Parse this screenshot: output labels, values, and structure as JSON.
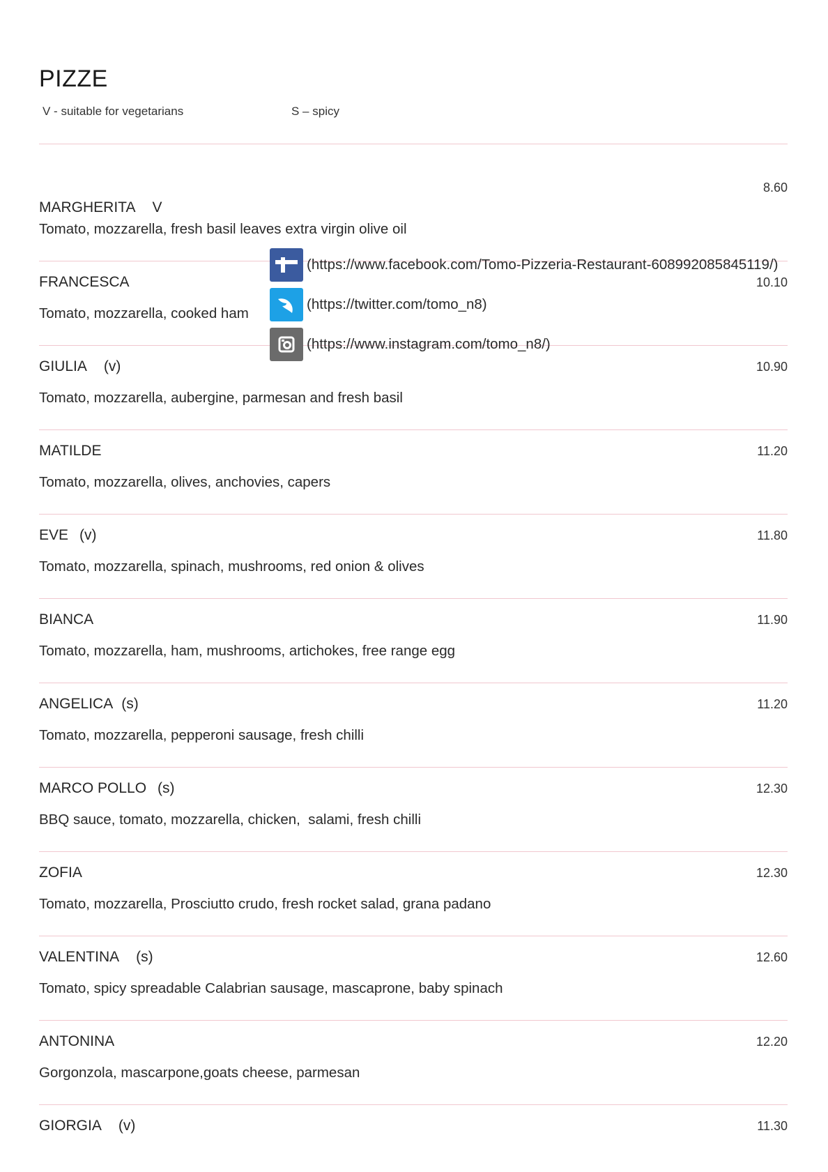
{
  "header": {
    "title": "PIZZE",
    "legend_v": "V - suitable for vegetarians",
    "legend_s": "S – spicy"
  },
  "colors": {
    "divider": "#f1c7cf",
    "facebook": "#3b5b9f",
    "twitter": "#1da1e6",
    "instagram": "#6b6b6b"
  },
  "social": [
    {
      "icon": "facebook-icon",
      "url": "(https://www.facebook.com/Tomo-Pizzeria-Restaurant-608992085845119/)"
    },
    {
      "icon": "twitter-icon",
      "url": "(https://twitter.com/tomo_n8)"
    },
    {
      "icon": "instagram-icon",
      "url": "(https://www.instagram.com/tomo_n8/)"
    }
  ],
  "items": [
    {
      "name": "MARGHERITA",
      "tag": "V",
      "desc": "Tomato, mozzarella, fresh basil leaves extra virgin olive oil",
      "price": "8.60"
    },
    {
      "name": "FRANCESCA",
      "tag": "",
      "desc": "Tomato, mozzarella, cooked ham",
      "price": "10.10"
    },
    {
      "name": "GIULIA",
      "tag": "(v)",
      "desc": "Tomato, mozzarella, aubergine, parmesan and fresh basil",
      "price": "10.90"
    },
    {
      "name": "MATILDE",
      "tag": "",
      "desc": "Tomato, mozzarella, olives, anchovies, capers",
      "price": "11.20"
    },
    {
      "name": "EVE",
      "tag": "(v)",
      "desc": "Tomato, mozzarella, spinach, mushrooms, red onion & olives",
      "price": "11.80"
    },
    {
      "name": "BIANCA",
      "tag": "",
      "desc": "Tomato, mozzarella, ham, mushrooms, artichokes, free range egg",
      "price": "11.90"
    },
    {
      "name": "ANGELICA",
      "tag": "(s)",
      "desc": "Tomato, mozzarella, pepperoni sausage, fresh chilli",
      "price": "11.20"
    },
    {
      "name": "MARCO POLLO",
      "tag": "(s)",
      "desc": "BBQ sauce, tomato, mozzarella, chicken,  salami, fresh chilli",
      "price": "12.30"
    },
    {
      "name": "ZOFIA",
      "tag": "",
      "desc": "Tomato, mozzarella, Prosciutto crudo, fresh rocket salad, grana padano",
      "price": "12.30"
    },
    {
      "name": "VALENTINA",
      "tag": "(s)",
      "desc": "Tomato, spicy spreadable Calabrian sausage, mascaprone, baby spinach",
      "price": "12.60"
    },
    {
      "name": "ANTONINA",
      "tag": "",
      "desc": "Gorgonzola, mascarpone,goats cheese, parmesan",
      "price": "12.20"
    },
    {
      "name": "GIORGIA",
      "tag": "(v)",
      "desc": "",
      "price": "11.30"
    }
  ]
}
